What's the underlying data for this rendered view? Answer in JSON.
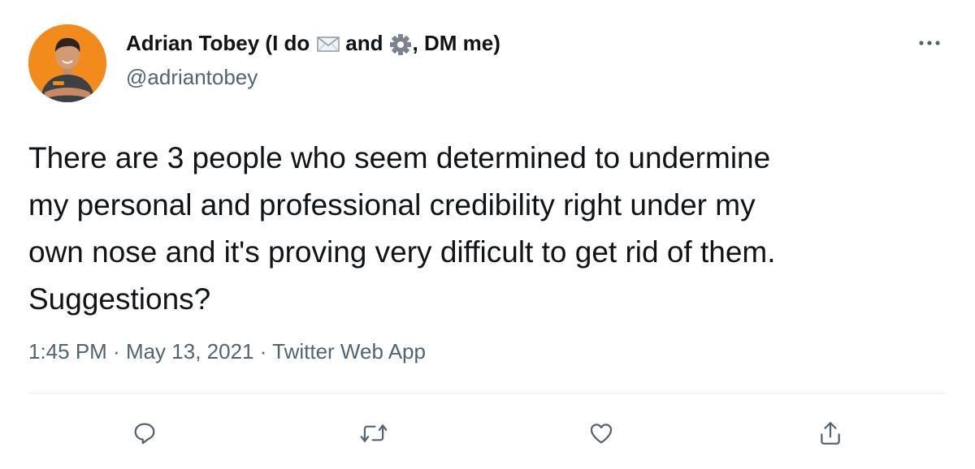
{
  "tweet": {
    "display_name_prefix": "Adrian Tobey (I do",
    "display_name_middle": "and",
    "display_name_suffix": ", DM me)",
    "emoji_1": "envelope-icon",
    "emoji_2": "gear-icon",
    "handle": "@adriantobey",
    "text": "There are 3 people who seem determined to undermine\nmy personal and professional credibility right under my\nown nose and it's proving very difficult to get rid of them.\nSuggestions?",
    "time": "1:45 PM",
    "separator_1": " · ",
    "date": "May 13, 2021",
    "separator_2": " · ",
    "source": "Twitter Web App"
  },
  "actions": [
    "reply-icon",
    "retweet-icon",
    "like-icon",
    "share-icon"
  ],
  "colors": {
    "text": "#0f1419",
    "secondary": "#536471",
    "avatar_bg": "#f28a1c",
    "divider": "#e6ecf0"
  }
}
